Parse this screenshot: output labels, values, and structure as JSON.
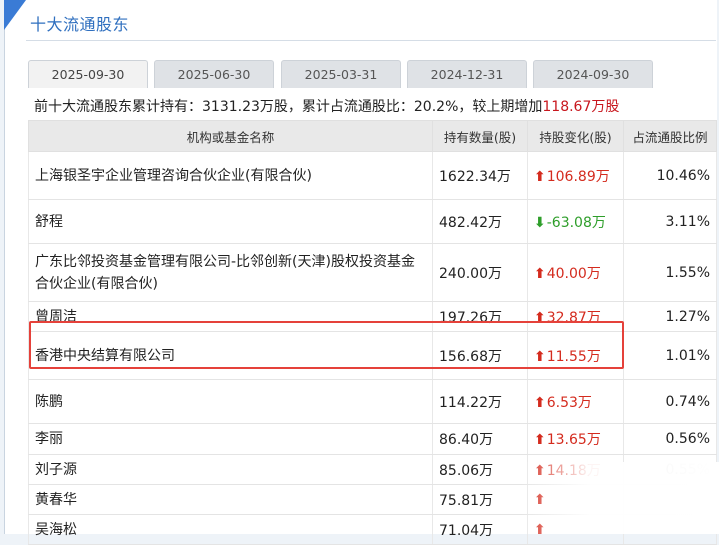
{
  "section": {
    "title": "十大流通股东"
  },
  "tabs": [
    {
      "label": "2025-09-30",
      "active": true
    },
    {
      "label": "2025-06-30",
      "active": false
    },
    {
      "label": "2025-03-31",
      "active": false
    },
    {
      "label": "2024-12-31",
      "active": false
    },
    {
      "label": "2024-09-30",
      "active": false
    }
  ],
  "summary": {
    "prefix": "前十大流通股东累计持有：3131.23万股，累计占流通股比：20.2%，较上期增加",
    "change": "118.67万股"
  },
  "table": {
    "headers": [
      "机构或基金名称",
      "持有数量(股)",
      "持股变化(股)",
      "占流通股比例"
    ],
    "rows": [
      {
        "name": "上海银圣宇企业管理咨询合伙企业(有限合伙)",
        "holding": "1622.34万",
        "direction": "up",
        "change": "106.89万",
        "ratio": "10.46%"
      },
      {
        "name": "舒程",
        "holding": "482.42万",
        "direction": "down",
        "change": "-63.08万",
        "ratio": "3.11%"
      },
      {
        "name": "广东比邻投资基金管理有限公司-比邻创新(天津)股权投资基金合伙企业(有限合伙)",
        "holding": "240.00万",
        "direction": "up",
        "change": "40.00万",
        "ratio": "1.55%"
      },
      {
        "name": "曾周洁",
        "holding": "197.26万",
        "direction": "up",
        "change": "32.87万",
        "ratio": "1.27%"
      },
      {
        "name": "香港中央结算有限公司",
        "holding": "156.68万",
        "direction": "up",
        "change": "11.55万",
        "ratio": "1.01%"
      },
      {
        "name": "陈鹏",
        "holding": "114.22万",
        "direction": "up",
        "change": "6.53万",
        "ratio": "0.74%"
      },
      {
        "name": "李丽",
        "holding": "86.40万",
        "direction": "up",
        "change": "13.65万",
        "ratio": "0.56%"
      },
      {
        "name": "刘子源",
        "holding": "85.06万",
        "direction": "up",
        "change": "14.18万",
        "ratio": "0.55%"
      },
      {
        "name": "黄春华",
        "holding": "75.81万",
        "direction": "up",
        "change": "",
        "ratio": ""
      },
      {
        "name": "吴海松",
        "holding": "71.04万",
        "direction": "up",
        "change": "",
        "ratio": ""
      }
    ]
  },
  "colors": {
    "accent": "#3a7bd5",
    "up": "#d42b1e",
    "down": "#2e9e2a",
    "highlight": "#e5413a"
  },
  "icons": {
    "up": "arrow-up-icon",
    "down": "arrow-down-icon"
  }
}
